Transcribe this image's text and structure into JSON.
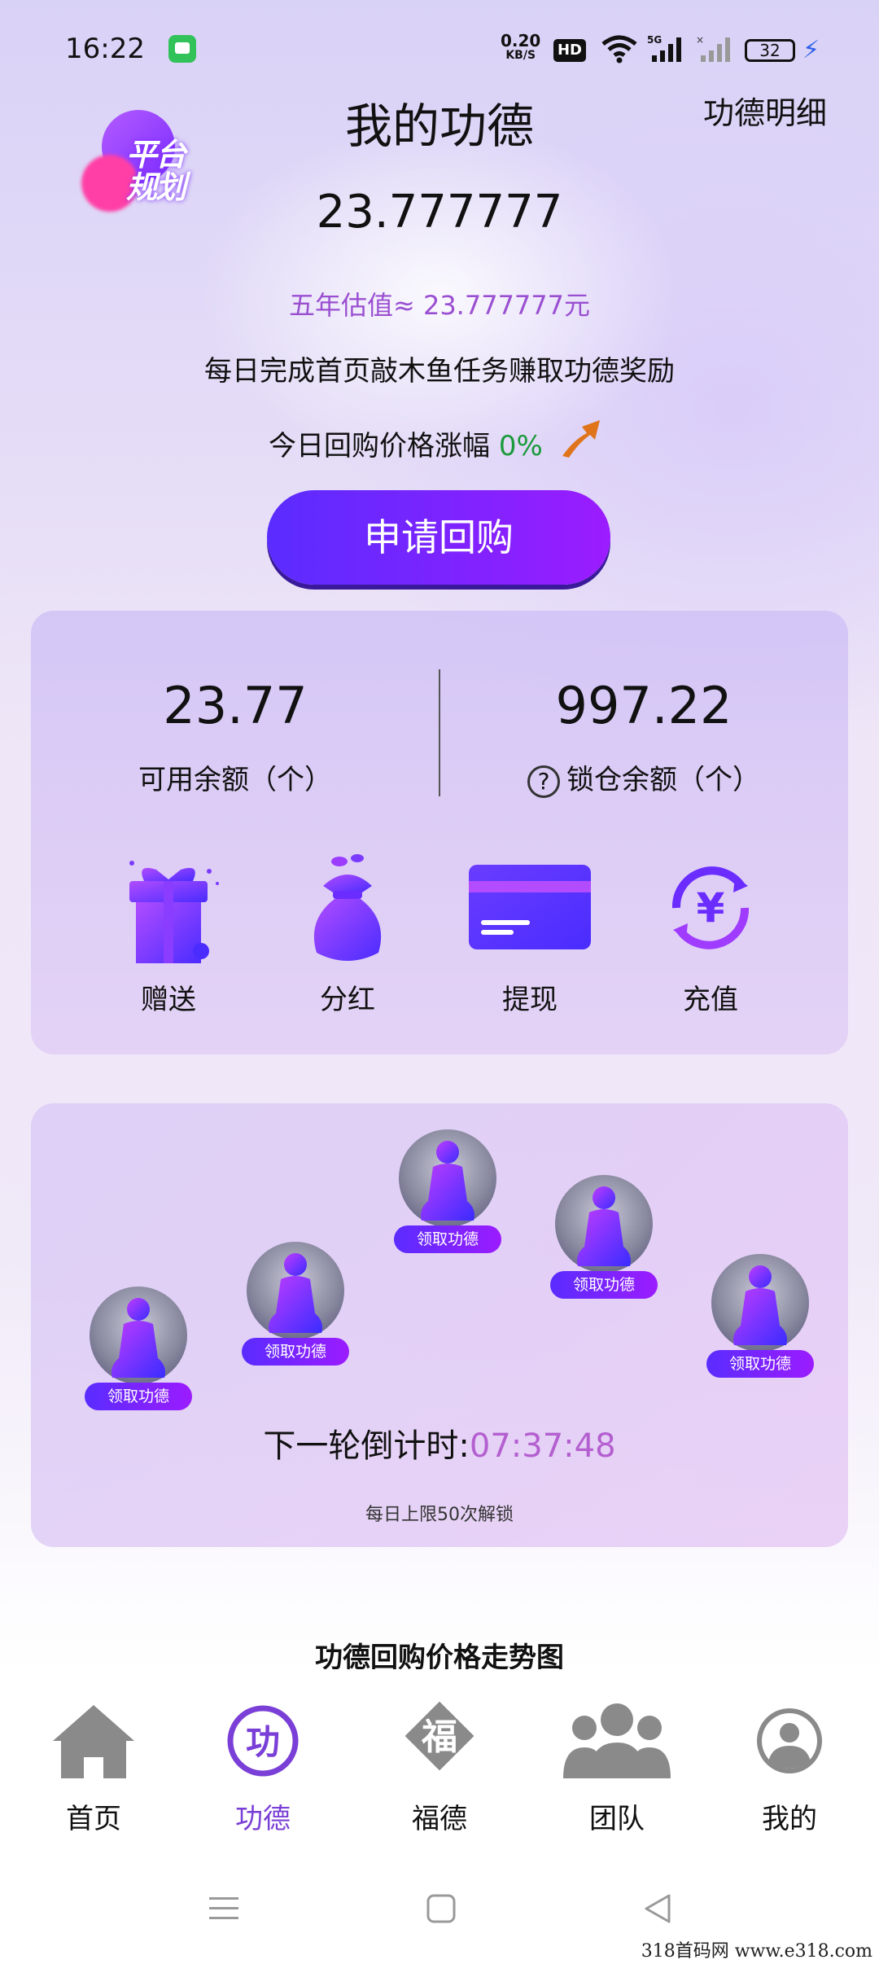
{
  "status_bar": {
    "time": "16:22",
    "net_speed_value": "0.20",
    "net_speed_unit": "KB/S",
    "hd_label": "HD",
    "network_label": "5G",
    "battery_level": "32"
  },
  "header": {
    "badge_text": "平台\n规划",
    "title": "我的功德",
    "detail_link": "功德明细"
  },
  "summary": {
    "merit_value": "23.777777",
    "estimate_text": "五年估值≈ 23.777777元",
    "task_text": "每日完成首页敲木鱼任务赚取功德奖励",
    "price_rise_label": "今日回购价格涨幅 ",
    "price_rise_value": "0%",
    "buyback_button": "申请回购"
  },
  "balance": {
    "available_value": "23.77",
    "available_label": "可用余额（个）",
    "locked_value": "997.22",
    "locked_label": "锁仓余额（个）",
    "question_mark": "?"
  },
  "actions": [
    {
      "label": "赠送",
      "icon": "gift-icon"
    },
    {
      "label": "分红",
      "icon": "money-bag-icon"
    },
    {
      "label": "提现",
      "icon": "bank-card-icon"
    },
    {
      "label": "充值",
      "icon": "yuan-exchange-icon"
    }
  ],
  "merit_collect": {
    "tag_label": "领取功德",
    "countdown_label": "下一轮倒计时:",
    "countdown_time": "07:37:48",
    "daily_limit": "每日上限50次解锁"
  },
  "trend_title": "功德回购价格走势图",
  "tabs": [
    {
      "label": "首页",
      "icon": "home-icon",
      "active": false
    },
    {
      "label": "功德",
      "icon": "merit-icon",
      "active": true,
      "glyph": "功"
    },
    {
      "label": "福德",
      "icon": "fortune-icon",
      "active": false,
      "glyph": "福"
    },
    {
      "label": "团队",
      "icon": "team-icon",
      "active": false
    },
    {
      "label": "我的",
      "icon": "profile-icon",
      "active": false
    }
  ],
  "colors": {
    "accent_purple": "#7a3fd6",
    "button_gradient_start": "#5a2cff",
    "button_gradient_end": "#9b1cff",
    "rise_green": "#1a9a3a",
    "countdown_pink": "#b45fd0"
  },
  "watermark": "318首码网   www.e318.com"
}
